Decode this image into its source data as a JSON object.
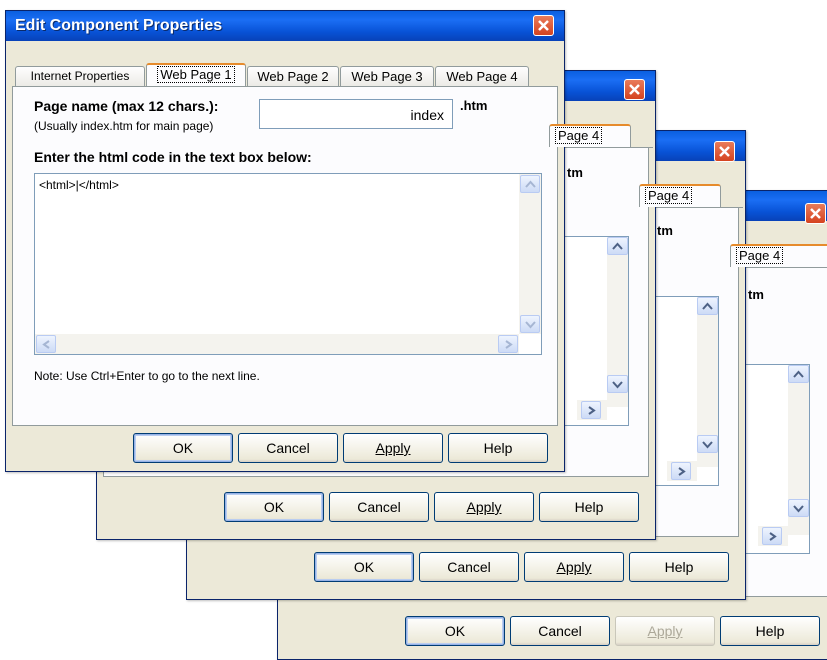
{
  "window": {
    "title": "Edit Component Properties",
    "close_label": "×"
  },
  "tabs": [
    "Internet Properties",
    "Web Page 1",
    "Web Page 2",
    "Web Page 3",
    "Web Page 4"
  ],
  "back_tab_fragment": "Page 4",
  "back_htm_fragment": "tm",
  "form": {
    "page_name_label": "Page name (max 12 chars.):",
    "page_name_hint": "(Usually index.htm for main page)",
    "page_name_value": "index",
    "extension": ".htm",
    "code_label": "Enter the html code in the text box below:",
    "code_value": "<html>|</html>",
    "note": "Note: Use Ctrl+Enter to go to the next line."
  },
  "buttons": {
    "ok": "OK",
    "cancel": "Cancel",
    "apply": "Apply",
    "help": "Help"
  },
  "colors": {
    "title_bar": "#0a5fe0",
    "active_tab_accent": "#e68b2c",
    "close_button": "#d5431f"
  }
}
